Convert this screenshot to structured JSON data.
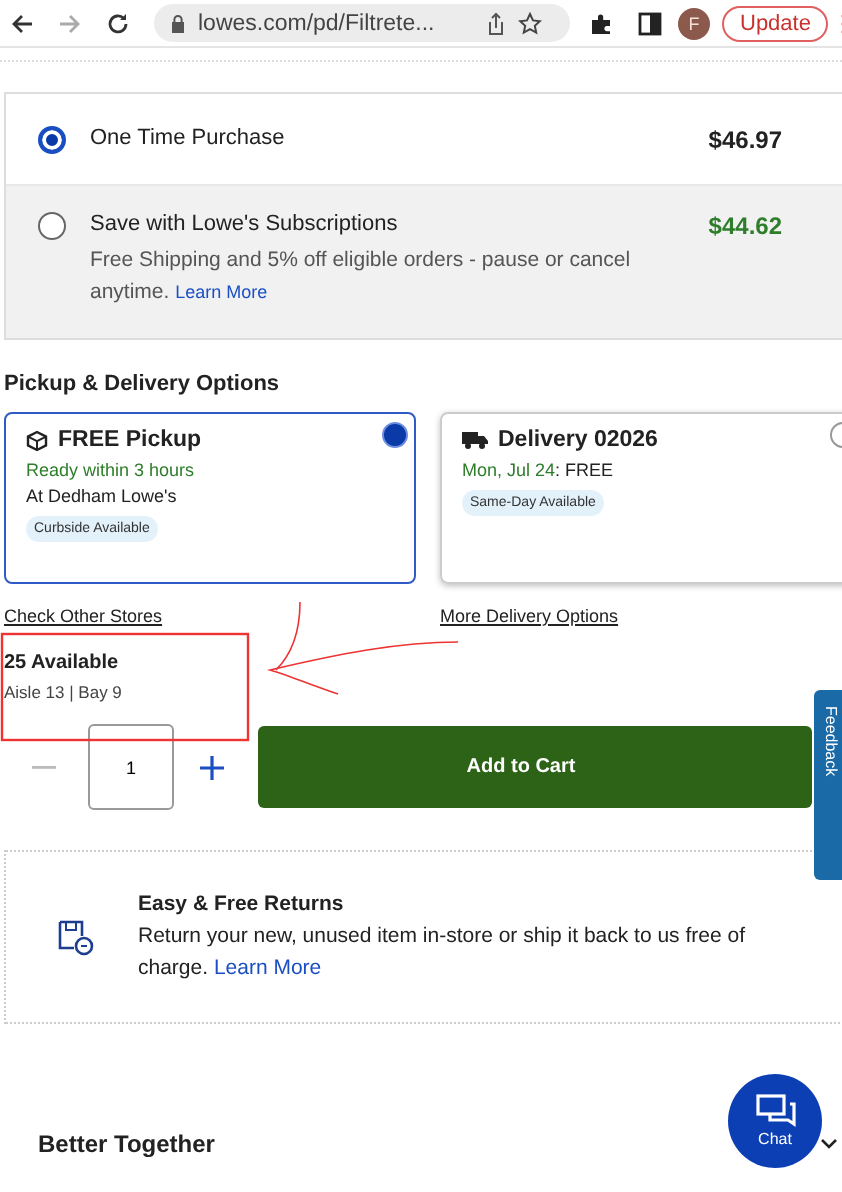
{
  "browser": {
    "url": "lowes.com/pd/Filtrete...",
    "profile_initial": "F",
    "update_button": "Update"
  },
  "purchase_options": [
    {
      "label": "One Time Purchase",
      "price": "$46.97",
      "selected": true
    },
    {
      "label": "Save with Lowe's Subscriptions",
      "price": "$44.62",
      "description": "Free Shipping and 5% off eligible orders - pause or cancel anytime.",
      "link": "Learn More",
      "selected": false
    }
  ],
  "fulfillment": {
    "title": "Pickup & Delivery Options",
    "options": [
      {
        "kind": "pickup",
        "title": "FREE Pickup",
        "availability": "Ready within 3 hours",
        "location": "At Dedham Lowe's",
        "badge": "Curbside Available",
        "link": "Check Other Stores",
        "selected": true
      },
      {
        "kind": "delivery",
        "title": "Delivery 02026",
        "availability": "Mon, Jul 24",
        "availability_suffix": ": FREE",
        "badge": "Same-Day Available",
        "link": "More Delivery Options",
        "selected": false
      }
    ]
  },
  "stock": {
    "count": "25 Available",
    "location": "Aisle 13 | Bay 9"
  },
  "quantity": "1",
  "add_to_cart": "Add to Cart",
  "returns": {
    "title": "Easy & Free Returns",
    "text": "Return your new, unused item in-store or ship it back to us free of charge.",
    "link": "Learn More"
  },
  "section_title": "Better Together",
  "feedback_tab": "Feedback",
  "chat_button": "Chat"
}
